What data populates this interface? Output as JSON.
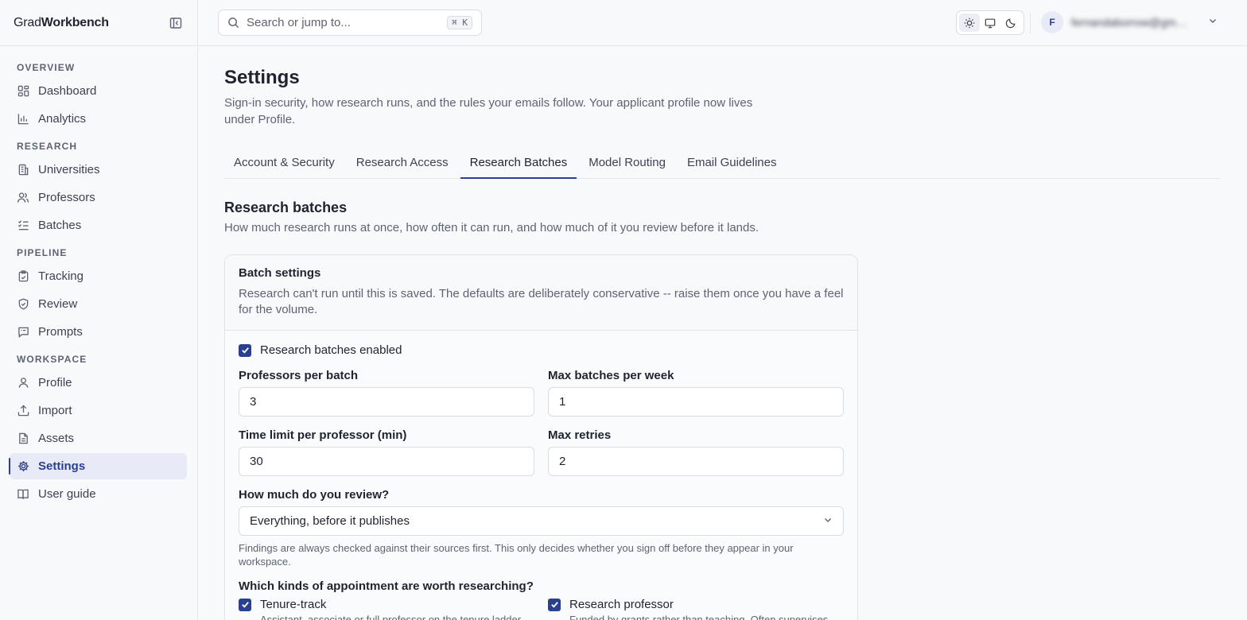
{
  "brand": {
    "prefix": "Grad",
    "suffix": "Workbench"
  },
  "sidebar": {
    "sections": [
      {
        "heading": "OVERVIEW",
        "items": [
          {
            "label": "Dashboard",
            "icon": "dashboard-icon"
          },
          {
            "label": "Analytics",
            "icon": "chart-icon"
          }
        ]
      },
      {
        "heading": "RESEARCH",
        "items": [
          {
            "label": "Universities",
            "icon": "building-icon"
          },
          {
            "label": "Professors",
            "icon": "users-icon"
          },
          {
            "label": "Batches",
            "icon": "list-checks-icon"
          }
        ]
      },
      {
        "heading": "PIPELINE",
        "items": [
          {
            "label": "Tracking",
            "icon": "clipboard-icon"
          },
          {
            "label": "Review",
            "icon": "shield-icon"
          },
          {
            "label": "Prompts",
            "icon": "message-icon"
          }
        ]
      },
      {
        "heading": "WORKSPACE",
        "items": [
          {
            "label": "Profile",
            "icon": "user-icon"
          },
          {
            "label": "Import",
            "icon": "upload-icon"
          },
          {
            "label": "Assets",
            "icon": "file-icon"
          },
          {
            "label": "Settings",
            "icon": "gear-icon",
            "active": true
          },
          {
            "label": "User guide",
            "icon": "book-icon"
          }
        ]
      }
    ]
  },
  "topbar": {
    "search_placeholder": "Search or jump to...",
    "search_shortcut": "⌘ K",
    "user_initial": "F",
    "user_name": "fernandaborrow@gmail.com"
  },
  "page": {
    "title": "Settings",
    "subtitle": "Sign-in security, how research runs, and the rules your emails follow. Your applicant profile now lives under Profile.",
    "tabs": [
      "Account & Security",
      "Research Access",
      "Research Batches",
      "Model Routing",
      "Email Guidelines"
    ],
    "active_tab": "Research Batches"
  },
  "section": {
    "title": "Research batches",
    "subtitle": "How much research runs at once, how often it can run, and how much of it you review before it lands."
  },
  "card": {
    "title": "Batch settings",
    "description": "Research can't run until this is saved. The defaults are deliberately conservative -- raise them once you have a feel for the volume.",
    "enabled_label": "Research batches enabled",
    "enabled": true,
    "fields": {
      "professors_per_batch": {
        "label": "Professors per batch",
        "value": "3"
      },
      "max_batches_per_week": {
        "label": "Max batches per week",
        "value": "1"
      },
      "time_limit": {
        "label": "Time limit per professor (min)",
        "value": "30"
      },
      "max_retries": {
        "label": "Max retries",
        "value": "2"
      }
    },
    "review": {
      "label": "How much do you review?",
      "selected": "Everything, before it publishes",
      "help": "Findings are always checked against their sources first. This only decides whether you sign off before they appear in your workspace."
    },
    "kinds": {
      "title": "Which kinds of appointment are worth researching?",
      "items": [
        {
          "label": "Tenure-track",
          "checked": true,
          "desc": "Assistant, associate or full professor on the tenure ladder."
        },
        {
          "label": "Research professor",
          "checked": true,
          "desc": "Funded by grants rather than teaching. Often supervises."
        }
      ]
    }
  },
  "colors": {
    "accent": "#2a3f8f",
    "active_bg": "#e8ebf7",
    "muted_text": "#5d6372"
  }
}
